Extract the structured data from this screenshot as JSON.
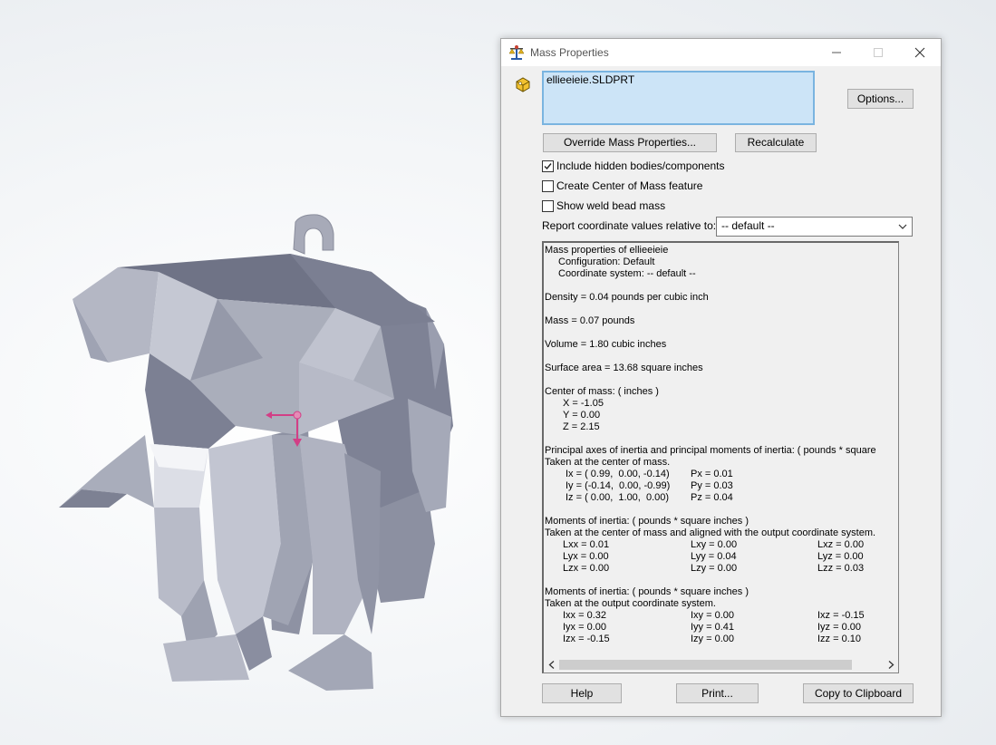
{
  "window": {
    "title": "Mass Properties",
    "icons": {
      "app": "balance-scale-icon",
      "part": "part-icon",
      "minimize": "minimize-icon",
      "maximize": "maximize-icon",
      "close": "close-icon"
    }
  },
  "file": {
    "name": "ellieeieie.SLDPRT"
  },
  "buttons": {
    "options": "Options...",
    "override": "Override Mass Properties...",
    "recalculate": "Recalculate",
    "help": "Help",
    "print": "Print...",
    "copy": "Copy to Clipboard"
  },
  "checkboxes": [
    {
      "label": "Include hidden bodies/components",
      "checked": true
    },
    {
      "label": "Create Center of Mass feature",
      "checked": false
    },
    {
      "label": "Show weld bead mass",
      "checked": false
    }
  ],
  "report_relative": {
    "label": "Report coordinate values relative to:",
    "value": "-- default --"
  },
  "results": {
    "header": "Mass properties of ellieeieie",
    "configuration": "Configuration: Default",
    "coordinate_system": "Coordinate system: -- default --",
    "density": "Density = 0.04 pounds per cubic inch",
    "mass": "Mass = 0.07 pounds",
    "volume": "Volume = 1.80 cubic inches",
    "surface_area": "Surface area = 13.68 square inches",
    "center_title": "Center of mass: ( inches )",
    "center": [
      "X = -1.05",
      "Y = 0.00",
      "Z = 2.15"
    ],
    "principal_title": "Principal axes of inertia and principal moments of inertia: ( pounds * square",
    "principal_sub": "Taken at the center of mass.",
    "principal_axes": [
      {
        "axis": "Ix = ( 0.99,  0.00, -0.14)",
        "moment": "Px = 0.01"
      },
      {
        "axis": "Iy = (-0.14,  0.00, -0.99)",
        "moment": "Py = 0.03"
      },
      {
        "axis": "Iz = ( 0.00,  1.00,  0.00)",
        "moment": "Pz = 0.04"
      }
    ],
    "moments1_title": "Moments of inertia: ( pounds * square inches )",
    "moments1_sub": "Taken at the center of mass and aligned with the output coordinate system.",
    "moments1": [
      [
        "Lxx = 0.01",
        "Lxy = 0.00",
        "Lxz = 0.00"
      ],
      [
        "Lyx = 0.00",
        "Lyy = 0.04",
        "Lyz = 0.00"
      ],
      [
        "Lzx = 0.00",
        "Lzy = 0.00",
        "Lzz = 0.03"
      ]
    ],
    "moments2_title": "Moments of inertia: ( pounds * square inches )",
    "moments2_sub": "Taken at the output coordinate system.",
    "moments2": [
      [
        "Ixx = 0.32",
        "Ixy = 0.00",
        "Ixz = -0.15"
      ],
      [
        "Iyx = 0.00",
        "Iyy = 0.41",
        "Iyz = 0.00"
      ],
      [
        "Izx = -0.15",
        "Izy = 0.00",
        "Izz = 0.10"
      ]
    ]
  }
}
